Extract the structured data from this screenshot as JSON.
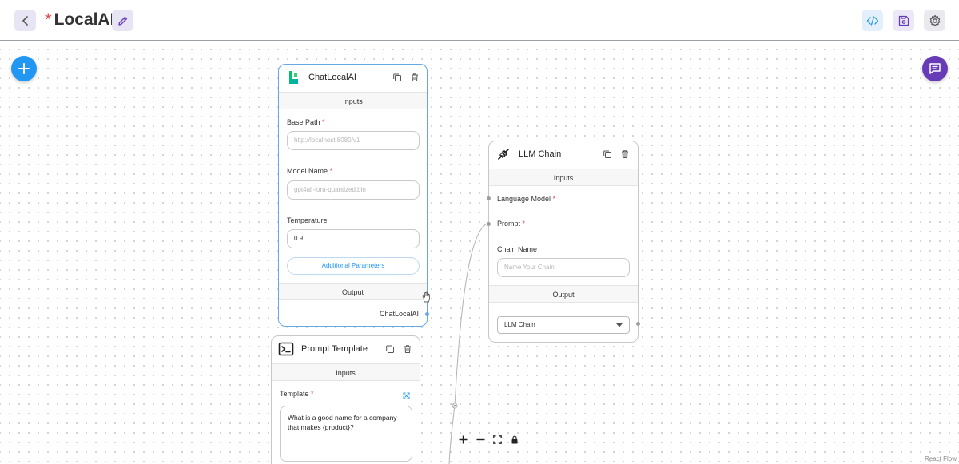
{
  "header": {
    "title": "LocalAI",
    "unsaved_marker": "*"
  },
  "nodes": {
    "chat_local_ai": {
      "title": "ChatLocalAI",
      "inputs_label": "Inputs",
      "base_path_label": "Base Path",
      "base_path_placeholder": "http://localhost:8080/v1",
      "model_name_label": "Model Name",
      "model_name_placeholder": "gpt4all-lora-quantized.bin",
      "temperature_label": "Temperature",
      "temperature_value": "0.9",
      "additional_params_label": "Additional Parameters",
      "output_label": "Output",
      "output_value": "ChatLocalAI"
    },
    "llm_chain": {
      "title": "LLM Chain",
      "inputs_label": "Inputs",
      "language_model_label": "Language Model",
      "prompt_label": "Prompt",
      "chain_name_label": "Chain Name",
      "chain_name_placeholder": "Name Your Chain",
      "output_label": "Output",
      "output_value": "LLM Chain"
    },
    "prompt_template": {
      "title": "Prompt Template",
      "inputs_label": "Inputs",
      "template_label": "Template",
      "template_value": "What is a good name for a company that makes {product}?"
    }
  },
  "required_marker": "*",
  "footer": {
    "attribution": "React Flow"
  },
  "colors": {
    "accent_blue": "#2196f3",
    "accent_purple": "#673ab7",
    "required_red": "#e04b4b",
    "selected_border": "#64a8e6"
  },
  "icons": [
    "chevron-left-icon",
    "pencil-icon",
    "code-icon",
    "save-icon",
    "gear-icon",
    "plus-icon",
    "chat-icon",
    "copy-icon",
    "trash-icon",
    "expand-icon",
    "zoom-in-icon",
    "zoom-out-icon",
    "fit-view-icon",
    "lock-icon"
  ]
}
